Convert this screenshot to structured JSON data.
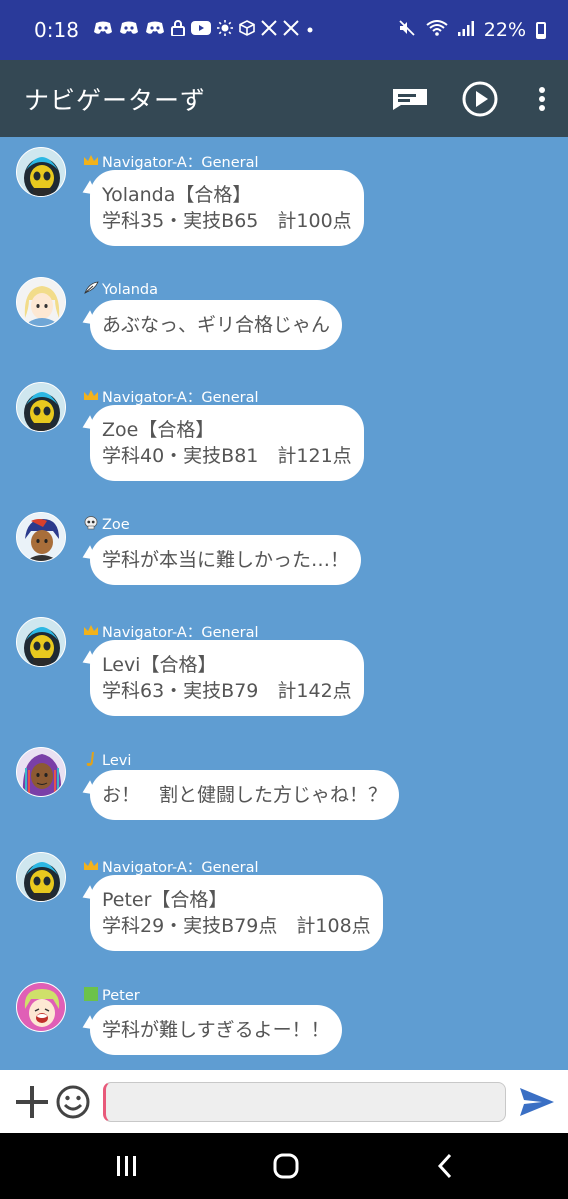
{
  "status_bar": {
    "time": "0:18",
    "battery": "22%",
    "icons": [
      "discord-icon",
      "discord-icon",
      "discord-icon",
      "lock-icon",
      "youtube-icon",
      "sun-icon",
      "cube-icon",
      "x-icon",
      "x-icon",
      "dot-icon",
      "mute-icon",
      "wifi-icon",
      "signal-icon",
      "battery-icon"
    ]
  },
  "app_bar": {
    "title": "ナビゲーターず",
    "actions": [
      "message-icon",
      "play-icon",
      "more-icon"
    ]
  },
  "messages": [
    {
      "sender": "Navigator-A：General",
      "badge": "crown-icon",
      "lines": [
        "Yolanda【合格】",
        "学科35・実技B65　計100点"
      ],
      "avatar": "navigator-a"
    },
    {
      "sender": "Yolanda",
      "badge": "feather-icon",
      "lines": [
        "あぶなっ、ギリ合格じゃん"
      ],
      "avatar": "yolanda"
    },
    {
      "sender": "Navigator-A：General",
      "badge": "crown-icon",
      "lines": [
        "Zoe【合格】",
        "学科40・実技B81　計121点"
      ],
      "avatar": "navigator-a"
    },
    {
      "sender": "Zoe",
      "badge": "skull-icon",
      "lines": [
        "学科が本当に難しかった…！"
      ],
      "avatar": "zoe"
    },
    {
      "sender": "Navigator-A：General",
      "badge": "crown-icon",
      "lines": [
        "Levi【合格】",
        "学科63・実技B79　計142点"
      ],
      "avatar": "navigator-a"
    },
    {
      "sender": "Levi",
      "badge": "saxophone-icon",
      "lines": [
        "お！　割と健闘した方じゃね！？"
      ],
      "avatar": "levi"
    },
    {
      "sender": "Navigator-A：General",
      "badge": "crown-icon",
      "lines": [
        "Peter【合格】",
        "学科29・実技B79点　計108点"
      ],
      "avatar": "navigator-a"
    },
    {
      "sender": "Peter",
      "badge": "green-square-icon",
      "lines": [
        "学科が難しすぎるよー！！"
      ],
      "avatar": "peter"
    }
  ],
  "input_bar": {
    "value": "",
    "placeholder": ""
  },
  "colors": {
    "status_bar": "#2a3a9a",
    "app_bar": "#344854",
    "chat_background": "#5f9dd2",
    "send_accent": "#3a6fc4",
    "input_caret": "#e8597a"
  }
}
